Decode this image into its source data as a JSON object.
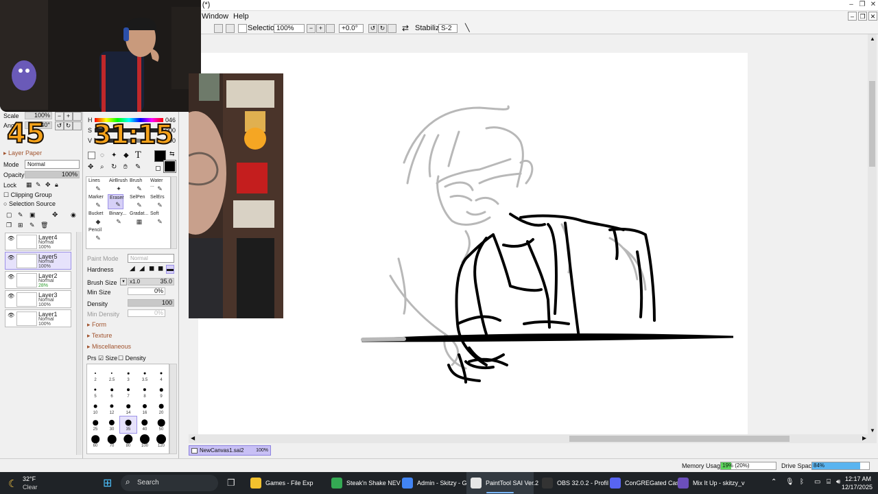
{
  "window": {
    "title_fragment": ") (*)",
    "min": "–",
    "max": "❐",
    "close": "✕"
  },
  "menu": {
    "window": "Window",
    "help": "Help"
  },
  "toolbar": {
    "selection_label": "Selection",
    "zoom": "100%",
    "rotation": "+0.0°",
    "stabilizer_label": "Stabilizer",
    "stabilizer_value": "S-2"
  },
  "nav": {
    "scale_label": "Scale",
    "scale_value": "100%",
    "angle_label": "Angle",
    "angle_value": "-40°"
  },
  "layer_panel": {
    "layer_paper": "Layer Paper",
    "mode_label": "Mode",
    "mode_value": "Normal",
    "opacity_label": "Opacity",
    "opacity_value": "100%",
    "opacity_level": 1.0,
    "lock_label": "Lock",
    "clipping_group": "Clipping Group",
    "selection_source": "Selection Source",
    "layers": [
      {
        "name": "Layer4",
        "mode": "Normal",
        "opacity": "100%",
        "selected": false
      },
      {
        "name": "Layer5",
        "mode": "Normal",
        "opacity": "100%",
        "selected": true
      },
      {
        "name": "Layer2",
        "mode": "Normal",
        "opacity": "28%",
        "selected": false
      },
      {
        "name": "Layer3",
        "mode": "Normal",
        "opacity": "100%",
        "selected": false
      },
      {
        "name": "Layer1",
        "mode": "Normal",
        "opacity": "100%",
        "selected": false
      }
    ]
  },
  "color": {
    "h_label": "H",
    "s_label": "S",
    "v_label": "V",
    "h_value": "046",
    "s_value": "000",
    "v_value": "000"
  },
  "tools": [
    {
      "name": "Lines",
      "icon": "✎"
    },
    {
      "name": "AirBrush",
      "icon": "✦"
    },
    {
      "name": "Brush",
      "icon": "✎"
    },
    {
      "name": "Water ...",
      "icon": "✎"
    },
    {
      "name": "Marker",
      "icon": "✎"
    },
    {
      "name": "Eraser",
      "icon": "✎"
    },
    {
      "name": "SelPen",
      "icon": "✎"
    },
    {
      "name": "SelErs",
      "icon": "✎"
    },
    {
      "name": "Bucket",
      "icon": "◆"
    },
    {
      "name": "Binary...",
      "icon": "✎"
    },
    {
      "name": "Gradat...",
      "icon": "▦"
    },
    {
      "name": "Soft",
      "icon": "✎"
    },
    {
      "name": "Pencil",
      "icon": "✎"
    }
  ],
  "brush": {
    "paint_mode_label": "Paint Mode",
    "paint_mode_value": "Normal",
    "hardness_label": "Hardness",
    "brush_size_label": "Brush Size",
    "brush_size_mult": "x1.0",
    "brush_size_value": "35.0",
    "min_size_label": "Min Size",
    "min_size_value": "0%",
    "density_label": "Density",
    "density_value": "100",
    "min_density_label": "Min Density",
    "min_density_value": "0%",
    "form": "Form",
    "texture": "Texture",
    "misc": "Miscellaneous",
    "prs_label": "Prs",
    "prs_size": "Size",
    "prs_density": "Density"
  },
  "brush_sizes": [
    "2",
    "2.5",
    "3",
    "3.5",
    "4",
    "5",
    "6",
    "7",
    "8",
    "9",
    "10",
    "12",
    "14",
    "16",
    "20",
    "25",
    "30",
    "35",
    "40",
    "50",
    "60",
    "70",
    "80",
    "100",
    "120"
  ],
  "overlay": {
    "count": "45",
    "timer": "31:15"
  },
  "file_tab": {
    "name": "NewCanvas1.sai2",
    "zoom": "100%"
  },
  "status": {
    "memory_label": "Memory Usage",
    "memory_value": "19% (20%)",
    "memory_level": 0.19,
    "drive_label": "Drive Space",
    "drive_value": "84%",
    "drive_level": 0.84
  },
  "taskbar": {
    "weather_temp": "32°F",
    "weather_desc": "Clear",
    "search": "Search",
    "apps": [
      {
        "label": "Games - File Exp",
        "color": "#f2c12e",
        "active": false
      },
      {
        "label": "Steak'n Shake NEV",
        "color": "#34a853",
        "active": false
      },
      {
        "label": "Admin - Skitzy - G",
        "color": "#4285f4",
        "active": false
      },
      {
        "label": "PaintTool SAI Ver.2",
        "color": "#e6e6e6",
        "active": true
      },
      {
        "label": "OBS 32.0.2 - Profil",
        "color": "#333333",
        "active": false
      },
      {
        "label": "ConGREGated Cas",
        "color": "#5865f2",
        "active": false
      },
      {
        "label": "Mix It Up - skitzy_v",
        "color": "#6b4fbb",
        "active": false
      }
    ],
    "time": "12:17 AM",
    "date": "12/17/2025"
  },
  "colors": {
    "accent": "#9d92e8",
    "selected_bg": "#e6e2fb",
    "memory_fill": "#5cd65c",
    "drive_fill": "#5ab4f0",
    "timer": "#f5a21a"
  }
}
